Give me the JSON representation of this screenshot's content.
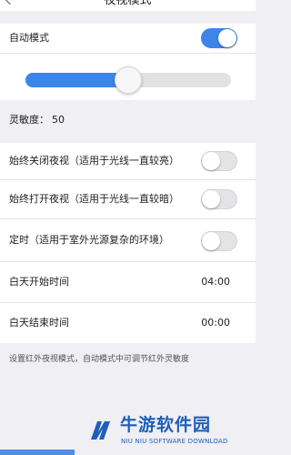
{
  "header": {
    "title": "夜视模式"
  },
  "auto_mode": {
    "label": "自动模式",
    "on": true
  },
  "sensitivity_slider": {
    "level_fraction": 0.5
  },
  "sensitivity": {
    "label": "灵敏度：",
    "value": "50"
  },
  "options": [
    {
      "label": "始终关闭夜视（适用于光线一直较亮）",
      "on": false
    },
    {
      "label": "始终打开夜视（适用于光线一直较暗）",
      "on": false
    },
    {
      "label": "定时（适用于室外光源复杂的环境）",
      "on": false
    }
  ],
  "day_start": {
    "label": "白天开始时间",
    "value": "04:00"
  },
  "day_end": {
    "label": "白天结束时间",
    "value": "00:00"
  },
  "footnote": "设置红外夜视模式，自动模式中可调节红外灵敏度",
  "watermark": {
    "cn": "牛游软件园",
    "en": "NIU NIU SOFTWARE DOWNLOAD"
  },
  "colors": {
    "accent": "#3b86e8",
    "watermark": "#1f5fb8"
  }
}
